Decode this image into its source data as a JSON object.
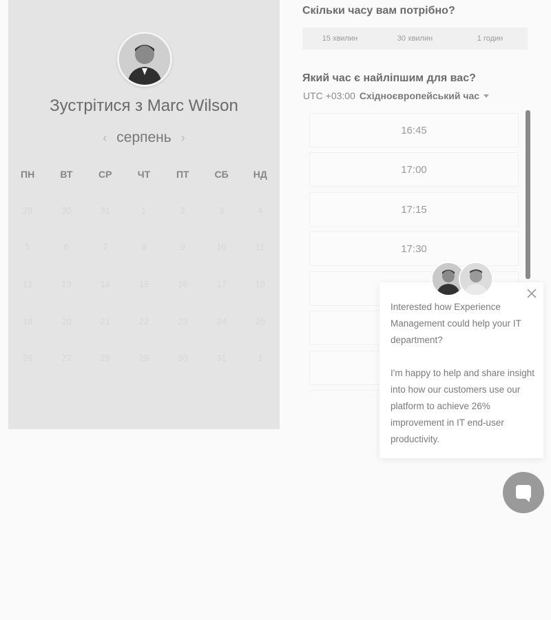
{
  "scheduler": {
    "title": "Зустрітися з Marc Wilson",
    "month": "серпень",
    "prev_arrow": "‹",
    "next_arrow": "›",
    "weekdays": [
      "ПН",
      "ВТ",
      "СР",
      "ЧТ",
      "ПТ",
      "СБ",
      "НД"
    ],
    "weeks": [
      [
        "29",
        "30",
        "31",
        "1",
        "2",
        "3",
        "4"
      ],
      [
        "5",
        "6",
        "7",
        "8",
        "9",
        "10",
        "11"
      ],
      [
        "12",
        "13",
        "14",
        "15",
        "16",
        "17",
        "18"
      ],
      [
        "19",
        "20",
        "21",
        "22",
        "23",
        "24",
        "25"
      ],
      [
        "26",
        "27",
        "28",
        "29",
        "30",
        "31",
        "1"
      ]
    ]
  },
  "duration": {
    "title": "Скільки часу вам потрібно?",
    "options": [
      "15 хвилин",
      "30 хвилин",
      "1 годин"
    ]
  },
  "time": {
    "title": "Який час є найліпшим для вас?",
    "timezone_offset": "UTC +03:00",
    "timezone_name": "Східноєвропейський час",
    "slots": [
      "16:45",
      "17:00",
      "17:15",
      "17:30",
      "",
      "",
      "",
      ""
    ]
  },
  "popup": {
    "close_symbol": "×",
    "paragraph1": "Interested how Experience Management could help your IT department?",
    "paragraph2": "I'm happy to help and share insight into how our customers use our platform to achieve 26% improvement in IT end-user productivity."
  },
  "icons": {
    "close": "close-icon",
    "chat": "chat-bubble-icon",
    "arrow_prev": "chevron-left-icon",
    "arrow_next": "chevron-right-icon",
    "caret": "caret-down-icon"
  }
}
